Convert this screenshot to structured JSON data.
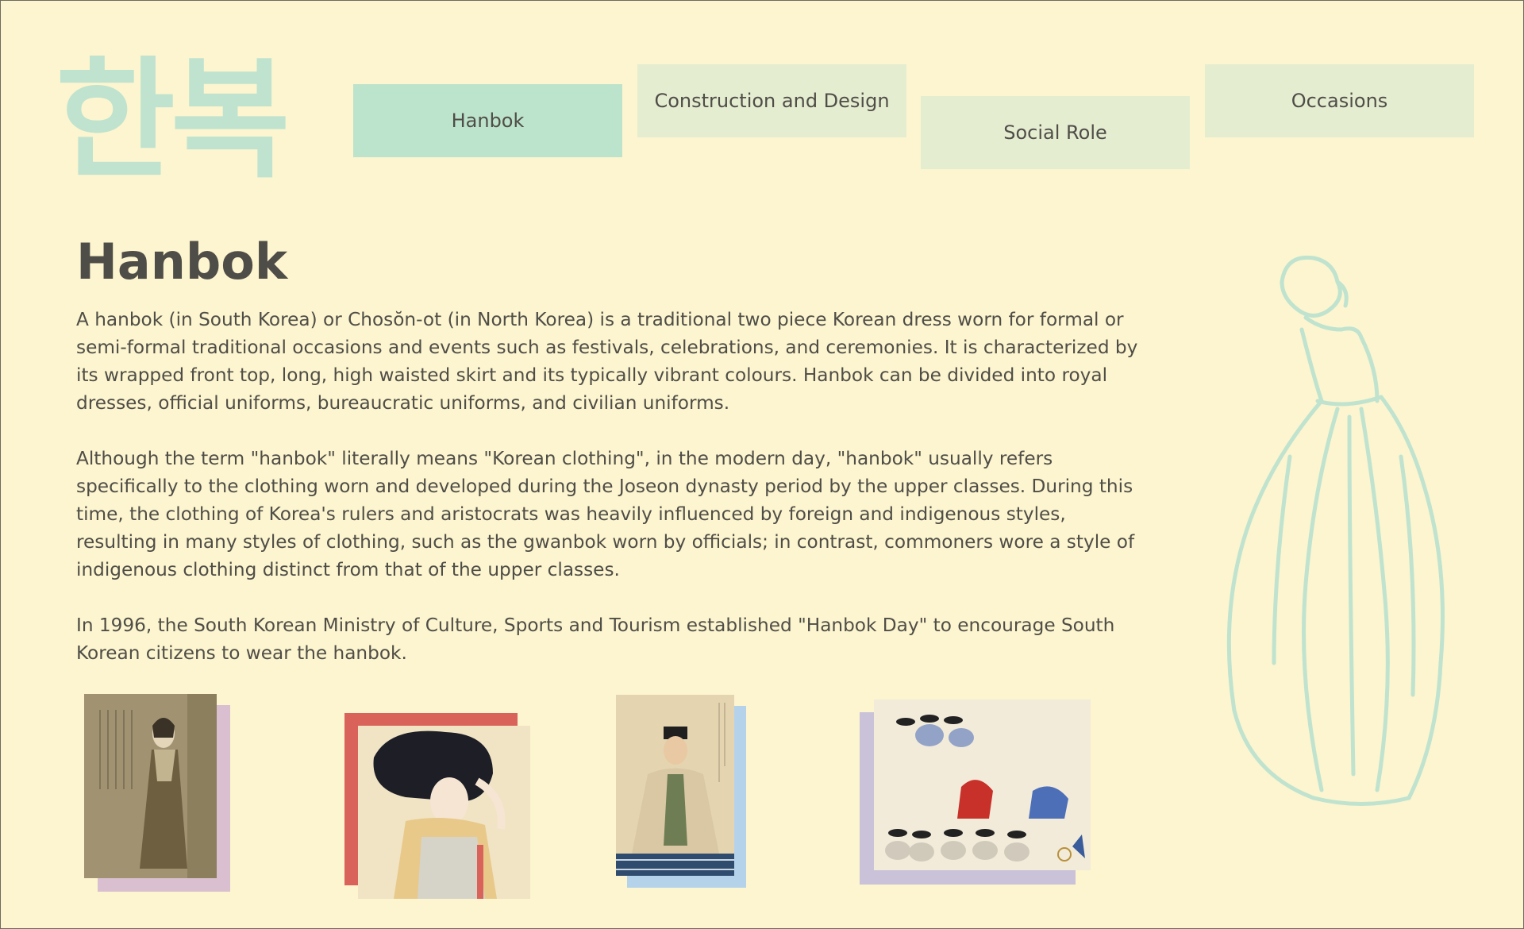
{
  "brand": {
    "logo_text": "한복",
    "logo_color": "#bfe3cf"
  },
  "nav": {
    "tabs": [
      {
        "label": "Hanbok",
        "active": true
      },
      {
        "label": "Construction and Design",
        "active": false
      },
      {
        "label": "Social Role",
        "active": false
      },
      {
        "label": "Occasions",
        "active": false
      }
    ]
  },
  "article": {
    "title": "Hanbok",
    "paragraphs": [
      "A hanbok (in South Korea) or Chosŏn-ot (in North Korea) is a traditional two piece Korean dress worn for formal or semi-formal traditional occasions and events such as festivals, celebrations, and ceremonies. It is characterized by its wrapped front top, long, high waisted skirt and its typically vibrant colours. Hanbok can be divided into royal dresses, official uniforms, bureaucratic uniforms, and civilian uniforms.",
      "Although the term \"hanbok\" literally means \"Korean clothing\", in the modern day, \"hanbok\" usually refers specifically to the clothing worn and developed during the Joseon dynasty period by the upper classes. During this time, the clothing of Korea's rulers and aristocrats was heavily influenced by foreign and indigenous styles, resulting in many styles of clothing, such as the gwanbok worn by officials; in contrast, commoners wore a style of indigenous clothing distinct from that of the upper classes.",
      "In 1996, the South Korean Ministry of Culture, Sports and Tourism established \"Hanbok Day\" to encourage South Korean citizens to wear the hanbok."
    ]
  },
  "gallery": [
    {
      "name": "painting-woman-by-wall",
      "frame_color": "#d9bfcf"
    },
    {
      "name": "painting-woman-fixing-hair",
      "frame_color": "#d9635a"
    },
    {
      "name": "portrait-seated-scholar",
      "frame_color": "#b4d3ea"
    },
    {
      "name": "painting-dance-gathering",
      "frame_color": "#c9c2d8"
    }
  ],
  "colors": {
    "background": "#fcf5cf",
    "tab_active": "#bce3cb",
    "tab_inactive": "#e5edd1",
    "text": "#4f4d47",
    "figure_outline": "#bfe3cf"
  }
}
